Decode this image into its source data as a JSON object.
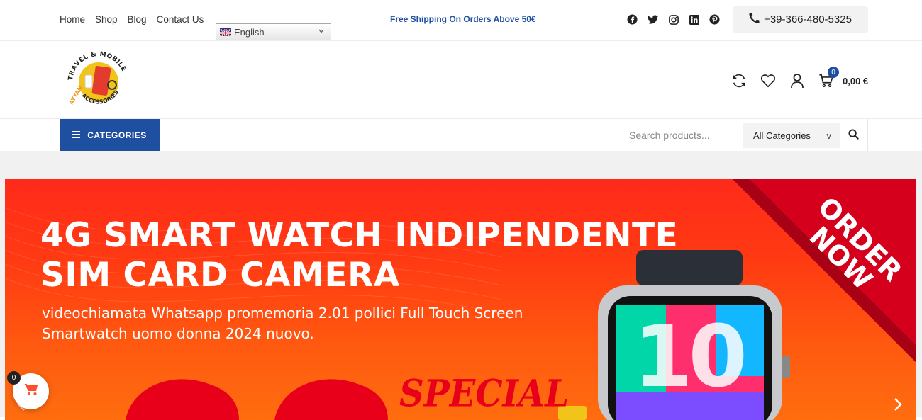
{
  "topbar": {
    "nav": [
      "Home",
      "Shop",
      "Blog",
      "Contact Us"
    ],
    "language": "English",
    "promo": "Free Shipping On Orders Above 50€",
    "social_icons": [
      "facebook-icon",
      "twitter-icon",
      "instagram-icon",
      "linkedin-icon",
      "pinterest-icon"
    ],
    "phone": "+39-366-480-5325"
  },
  "header": {
    "logo_text_top": "TRAVEL & MOBILE",
    "logo_text_right": "ACCESSORIES",
    "logo_text_bottom": "AYYAN",
    "cart_count": "0",
    "cart_total": "0,00 €"
  },
  "navbar": {
    "categories_label": "CATEGORIES",
    "search_placeholder": "Search products...",
    "all_categories": "All Categories",
    "dropdown_marker": "v"
  },
  "slider": {
    "headline_1": "4G SMART WATCH INDIPENDENTE",
    "headline_2": "SIM CARD CAMERA",
    "sub_1": "videochiamata Whatsapp promemoria 2.01 pollici Full Touch Screen",
    "sub_2": "Smartwatch uomo donna 2024 nuovo.",
    "order_1": "ORDER",
    "order_2": "NOW",
    "special": "SPECIAL",
    "watch_number": "10"
  },
  "floating_cart": {
    "count": "0"
  },
  "colors": {
    "brand_blue": "#1f4fa0",
    "banner_red": "#ff2a1a",
    "banner_orange": "#ff6d0f"
  }
}
